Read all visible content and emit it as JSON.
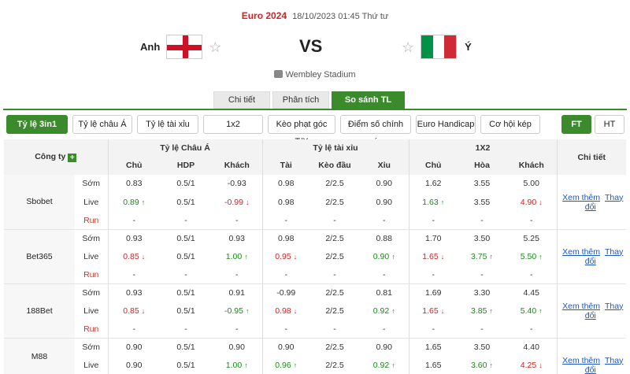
{
  "match": {
    "league": "Euro 2024",
    "datetime": "18/10/2023 01:45 Thứ tư",
    "home": "Anh",
    "away": "Ý",
    "vs": "VS",
    "stadium": "Wembley Stadium",
    "colors": {
      "accent": "#3b8a2c",
      "league": "#d0232a",
      "up": "#1a8a1a",
      "down": "#d02525"
    }
  },
  "tabs": [
    "Chi tiết",
    "Phân tích",
    "So sánh TL"
  ],
  "filters": [
    "Tỷ lệ 3in1",
    "Tỷ lệ châu Á",
    "Tỷ lệ tài xỉu",
    "1x2",
    "Kèo phạt góc T/X",
    "Điểm số chính xác",
    "Euro Handicap",
    "Cơ hội kép"
  ],
  "periods": [
    "FT",
    "HT"
  ],
  "table": {
    "company_header": "Công ty",
    "groups": [
      "Tỷ lệ Châu Á",
      "Tỷ lệ tài xỉu",
      "1X2"
    ],
    "detail_header": "Chi tiết",
    "subheaders": [
      "Chủ",
      "HDP",
      "Khách",
      "Tài",
      "Kèo đầu",
      "Xỉu",
      "Chủ",
      "Hòa",
      "Khách"
    ],
    "row_types": [
      "Sớm",
      "Live",
      "Run"
    ],
    "link_more": "Xem thêm",
    "link_change": "Thay đổi",
    "companies": [
      {
        "name": "Sbobet",
        "rows": [
          [
            "0.83",
            "0.5/1",
            "-0.93",
            "0.98",
            "2/2.5",
            "0.90",
            "1.62",
            "3.55",
            "5.00"
          ],
          [
            "0.89",
            "0.5/1",
            "-0.99",
            "0.98",
            "2/2.5",
            "0.90",
            "1.63",
            "3.55",
            "4.90"
          ],
          [
            "-",
            "-",
            "-",
            "-",
            "-",
            "-",
            "-",
            "-",
            "-"
          ]
        ],
        "live_dirs": [
          "up",
          "",
          "down",
          "",
          "",
          "",
          "up",
          "",
          "down"
        ]
      },
      {
        "name": "Bet365",
        "rows": [
          [
            "0.93",
            "0.5/1",
            "0.93",
            "0.98",
            "2/2.5",
            "0.88",
            "1.70",
            "3.50",
            "5.25"
          ],
          [
            "0.85",
            "0.5/1",
            "1.00",
            "0.95",
            "2/2.5",
            "0.90",
            "1.65",
            "3.75",
            "5.50"
          ],
          [
            "-",
            "-",
            "-",
            "-",
            "-",
            "-",
            "-",
            "-",
            "-"
          ]
        ],
        "live_dirs": [
          "down",
          "",
          "up",
          "down",
          "",
          "up",
          "down",
          "up",
          "up"
        ]
      },
      {
        "name": "188Bet",
        "rows": [
          [
            "0.93",
            "0.5/1",
            "0.91",
            "-0.99",
            "2/2.5",
            "0.81",
            "1.69",
            "3.30",
            "4.45"
          ],
          [
            "0.85",
            "0.5/1",
            "-0.95",
            "0.98",
            "2/2.5",
            "0.92",
            "1.65",
            "3.85",
            "5.40"
          ],
          [
            "-",
            "-",
            "-",
            "-",
            "-",
            "-",
            "-",
            "-",
            "-"
          ]
        ],
        "live_dirs": [
          "down",
          "",
          "up",
          "down",
          "",
          "up",
          "down",
          "up",
          "up"
        ]
      },
      {
        "name": "M88",
        "rows": [
          [
            "0.90",
            "0.5/1",
            "0.90",
            "0.90",
            "2/2.5",
            "0.90",
            "1.65",
            "3.50",
            "4.40"
          ],
          [
            "0.90",
            "0.5/1",
            "1.00",
            "0.96",
            "2/2.5",
            "0.92",
            "1.65",
            "3.60",
            "4.25"
          ]
        ],
        "live_dirs": [
          "",
          "",
          "up",
          "up",
          "",
          "up",
          "",
          "up",
          "down"
        ]
      }
    ]
  }
}
